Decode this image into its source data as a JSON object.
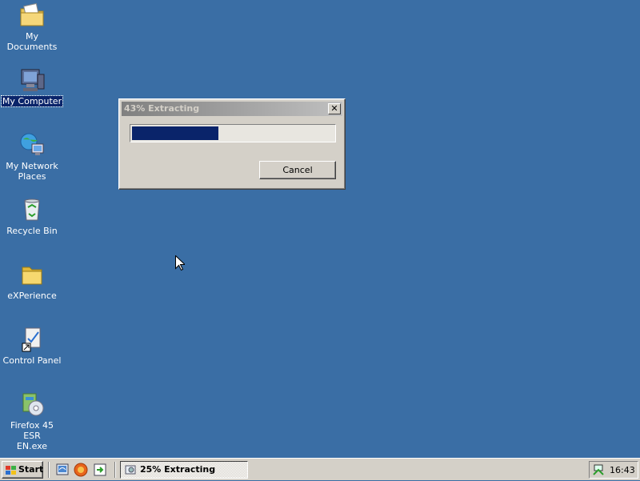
{
  "desktop": {
    "icons": [
      {
        "label": "My Documents",
        "icon": "my-documents-folder-icon"
      },
      {
        "label": "My Computer",
        "icon": "my-computer-icon"
      },
      {
        "label": "My Network\nPlaces",
        "icon": "network-places-icon"
      },
      {
        "label": "Recycle Bin",
        "icon": "recycle-bin-icon"
      },
      {
        "label": "eXPerience",
        "icon": "folder-icon"
      },
      {
        "label": "Control Panel",
        "icon": "control-panel-icon"
      },
      {
        "label": "Firefox 45 ESR\nEN.exe",
        "icon": "installer-exe-icon"
      }
    ]
  },
  "dialog": {
    "title": "43% Extracting",
    "close_label": "✕",
    "progress_fraction": 0.43,
    "cancel_label": "Cancel"
  },
  "taskbar": {
    "start_label": "Start",
    "quick_launch": [
      "show-desktop-icon",
      "browser-icon",
      "launch-icon"
    ],
    "task_label": "25% Extracting",
    "clock": "16:43"
  },
  "colors": {
    "desktop_bg": "#3a6ea5",
    "progress_fill": "#0a246a",
    "window_face": "#d4d0c8"
  }
}
